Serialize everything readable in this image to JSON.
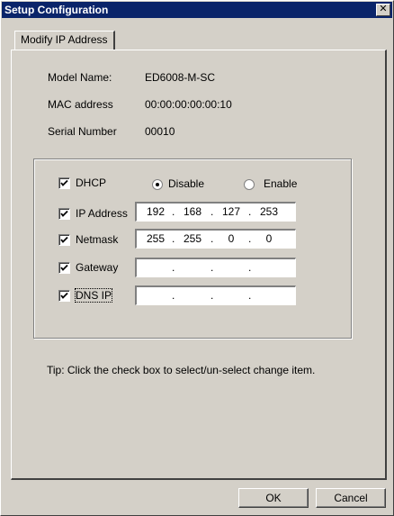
{
  "window": {
    "title": "Setup Configuration",
    "close_glyph": "✕"
  },
  "tabs": [
    {
      "label": "Modify IP Address",
      "selected": true
    }
  ],
  "device_info": [
    {
      "label": "Model Name:",
      "value": "ED6008-M-SC"
    },
    {
      "label": "MAC address",
      "value": "00:00:00:00:00:10"
    },
    {
      "label": "Serial Number",
      "value": "00010"
    }
  ],
  "dhcp": {
    "label": "DHCP",
    "checked": true,
    "options": [
      {
        "label": "Disable",
        "selected": true
      },
      {
        "label": "Enable",
        "selected": false
      }
    ]
  },
  "fields": [
    {
      "label": "IP Address",
      "checked": true,
      "octets": [
        "192",
        "168",
        "127",
        "253"
      ]
    },
    {
      "label": "Netmask",
      "checked": true,
      "octets": [
        "255",
        "255",
        "0",
        "0"
      ]
    },
    {
      "label": "Gateway",
      "checked": true,
      "octets": [
        "",
        "",
        "",
        ""
      ]
    },
    {
      "label": "DNS IP",
      "checked": true,
      "octets": [
        "",
        "",
        "",
        ""
      ]
    }
  ],
  "tip": "Tip: Click the check box to select/un-select change item.",
  "buttons": {
    "ok": "OK",
    "cancel": "Cancel"
  }
}
